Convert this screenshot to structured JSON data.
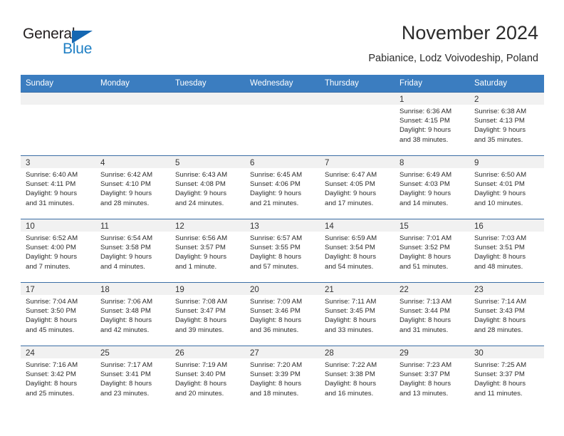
{
  "brand": {
    "name_part1": "General",
    "name_part2": "Blue",
    "color_primary": "#1567b2",
    "color_secondary": "#1f7fc4"
  },
  "header": {
    "title": "November 2024",
    "subtitle": "Pabianice, Lodz Voivodeship, Poland"
  },
  "theme": {
    "header_bar": "#3b7dc0",
    "row_divider": "#3b6ea5",
    "day_band": "#f1f1f1"
  },
  "weekdays": [
    "Sunday",
    "Monday",
    "Tuesday",
    "Wednesday",
    "Thursday",
    "Friday",
    "Saturday"
  ],
  "weeks": [
    [
      {
        "day": "",
        "empty": true
      },
      {
        "day": "",
        "empty": true
      },
      {
        "day": "",
        "empty": true
      },
      {
        "day": "",
        "empty": true
      },
      {
        "day": "",
        "empty": true
      },
      {
        "day": "1",
        "sunrise": "Sunrise: 6:36 AM",
        "sunset": "Sunset: 4:15 PM",
        "daylight1": "Daylight: 9 hours",
        "daylight2": "and 38 minutes."
      },
      {
        "day": "2",
        "sunrise": "Sunrise: 6:38 AM",
        "sunset": "Sunset: 4:13 PM",
        "daylight1": "Daylight: 9 hours",
        "daylight2": "and 35 minutes."
      }
    ],
    [
      {
        "day": "3",
        "sunrise": "Sunrise: 6:40 AM",
        "sunset": "Sunset: 4:11 PM",
        "daylight1": "Daylight: 9 hours",
        "daylight2": "and 31 minutes."
      },
      {
        "day": "4",
        "sunrise": "Sunrise: 6:42 AM",
        "sunset": "Sunset: 4:10 PM",
        "daylight1": "Daylight: 9 hours",
        "daylight2": "and 28 minutes."
      },
      {
        "day": "5",
        "sunrise": "Sunrise: 6:43 AM",
        "sunset": "Sunset: 4:08 PM",
        "daylight1": "Daylight: 9 hours",
        "daylight2": "and 24 minutes."
      },
      {
        "day": "6",
        "sunrise": "Sunrise: 6:45 AM",
        "sunset": "Sunset: 4:06 PM",
        "daylight1": "Daylight: 9 hours",
        "daylight2": "and 21 minutes."
      },
      {
        "day": "7",
        "sunrise": "Sunrise: 6:47 AM",
        "sunset": "Sunset: 4:05 PM",
        "daylight1": "Daylight: 9 hours",
        "daylight2": "and 17 minutes."
      },
      {
        "day": "8",
        "sunrise": "Sunrise: 6:49 AM",
        "sunset": "Sunset: 4:03 PM",
        "daylight1": "Daylight: 9 hours",
        "daylight2": "and 14 minutes."
      },
      {
        "day": "9",
        "sunrise": "Sunrise: 6:50 AM",
        "sunset": "Sunset: 4:01 PM",
        "daylight1": "Daylight: 9 hours",
        "daylight2": "and 10 minutes."
      }
    ],
    [
      {
        "day": "10",
        "sunrise": "Sunrise: 6:52 AM",
        "sunset": "Sunset: 4:00 PM",
        "daylight1": "Daylight: 9 hours",
        "daylight2": "and 7 minutes."
      },
      {
        "day": "11",
        "sunrise": "Sunrise: 6:54 AM",
        "sunset": "Sunset: 3:58 PM",
        "daylight1": "Daylight: 9 hours",
        "daylight2": "and 4 minutes."
      },
      {
        "day": "12",
        "sunrise": "Sunrise: 6:56 AM",
        "sunset": "Sunset: 3:57 PM",
        "daylight1": "Daylight: 9 hours",
        "daylight2": "and 1 minute."
      },
      {
        "day": "13",
        "sunrise": "Sunrise: 6:57 AM",
        "sunset": "Sunset: 3:55 PM",
        "daylight1": "Daylight: 8 hours",
        "daylight2": "and 57 minutes."
      },
      {
        "day": "14",
        "sunrise": "Sunrise: 6:59 AM",
        "sunset": "Sunset: 3:54 PM",
        "daylight1": "Daylight: 8 hours",
        "daylight2": "and 54 minutes."
      },
      {
        "day": "15",
        "sunrise": "Sunrise: 7:01 AM",
        "sunset": "Sunset: 3:52 PM",
        "daylight1": "Daylight: 8 hours",
        "daylight2": "and 51 minutes."
      },
      {
        "day": "16",
        "sunrise": "Sunrise: 7:03 AM",
        "sunset": "Sunset: 3:51 PM",
        "daylight1": "Daylight: 8 hours",
        "daylight2": "and 48 minutes."
      }
    ],
    [
      {
        "day": "17",
        "sunrise": "Sunrise: 7:04 AM",
        "sunset": "Sunset: 3:50 PM",
        "daylight1": "Daylight: 8 hours",
        "daylight2": "and 45 minutes."
      },
      {
        "day": "18",
        "sunrise": "Sunrise: 7:06 AM",
        "sunset": "Sunset: 3:48 PM",
        "daylight1": "Daylight: 8 hours",
        "daylight2": "and 42 minutes."
      },
      {
        "day": "19",
        "sunrise": "Sunrise: 7:08 AM",
        "sunset": "Sunset: 3:47 PM",
        "daylight1": "Daylight: 8 hours",
        "daylight2": "and 39 minutes."
      },
      {
        "day": "20",
        "sunrise": "Sunrise: 7:09 AM",
        "sunset": "Sunset: 3:46 PM",
        "daylight1": "Daylight: 8 hours",
        "daylight2": "and 36 minutes."
      },
      {
        "day": "21",
        "sunrise": "Sunrise: 7:11 AM",
        "sunset": "Sunset: 3:45 PM",
        "daylight1": "Daylight: 8 hours",
        "daylight2": "and 33 minutes."
      },
      {
        "day": "22",
        "sunrise": "Sunrise: 7:13 AM",
        "sunset": "Sunset: 3:44 PM",
        "daylight1": "Daylight: 8 hours",
        "daylight2": "and 31 minutes."
      },
      {
        "day": "23",
        "sunrise": "Sunrise: 7:14 AM",
        "sunset": "Sunset: 3:43 PM",
        "daylight1": "Daylight: 8 hours",
        "daylight2": "and 28 minutes."
      }
    ],
    [
      {
        "day": "24",
        "sunrise": "Sunrise: 7:16 AM",
        "sunset": "Sunset: 3:42 PM",
        "daylight1": "Daylight: 8 hours",
        "daylight2": "and 25 minutes."
      },
      {
        "day": "25",
        "sunrise": "Sunrise: 7:17 AM",
        "sunset": "Sunset: 3:41 PM",
        "daylight1": "Daylight: 8 hours",
        "daylight2": "and 23 minutes."
      },
      {
        "day": "26",
        "sunrise": "Sunrise: 7:19 AM",
        "sunset": "Sunset: 3:40 PM",
        "daylight1": "Daylight: 8 hours",
        "daylight2": "and 20 minutes."
      },
      {
        "day": "27",
        "sunrise": "Sunrise: 7:20 AM",
        "sunset": "Sunset: 3:39 PM",
        "daylight1": "Daylight: 8 hours",
        "daylight2": "and 18 minutes."
      },
      {
        "day": "28",
        "sunrise": "Sunrise: 7:22 AM",
        "sunset": "Sunset: 3:38 PM",
        "daylight1": "Daylight: 8 hours",
        "daylight2": "and 16 minutes."
      },
      {
        "day": "29",
        "sunrise": "Sunrise: 7:23 AM",
        "sunset": "Sunset: 3:37 PM",
        "daylight1": "Daylight: 8 hours",
        "daylight2": "and 13 minutes."
      },
      {
        "day": "30",
        "sunrise": "Sunrise: 7:25 AM",
        "sunset": "Sunset: 3:37 PM",
        "daylight1": "Daylight: 8 hours",
        "daylight2": "and 11 minutes."
      }
    ]
  ]
}
